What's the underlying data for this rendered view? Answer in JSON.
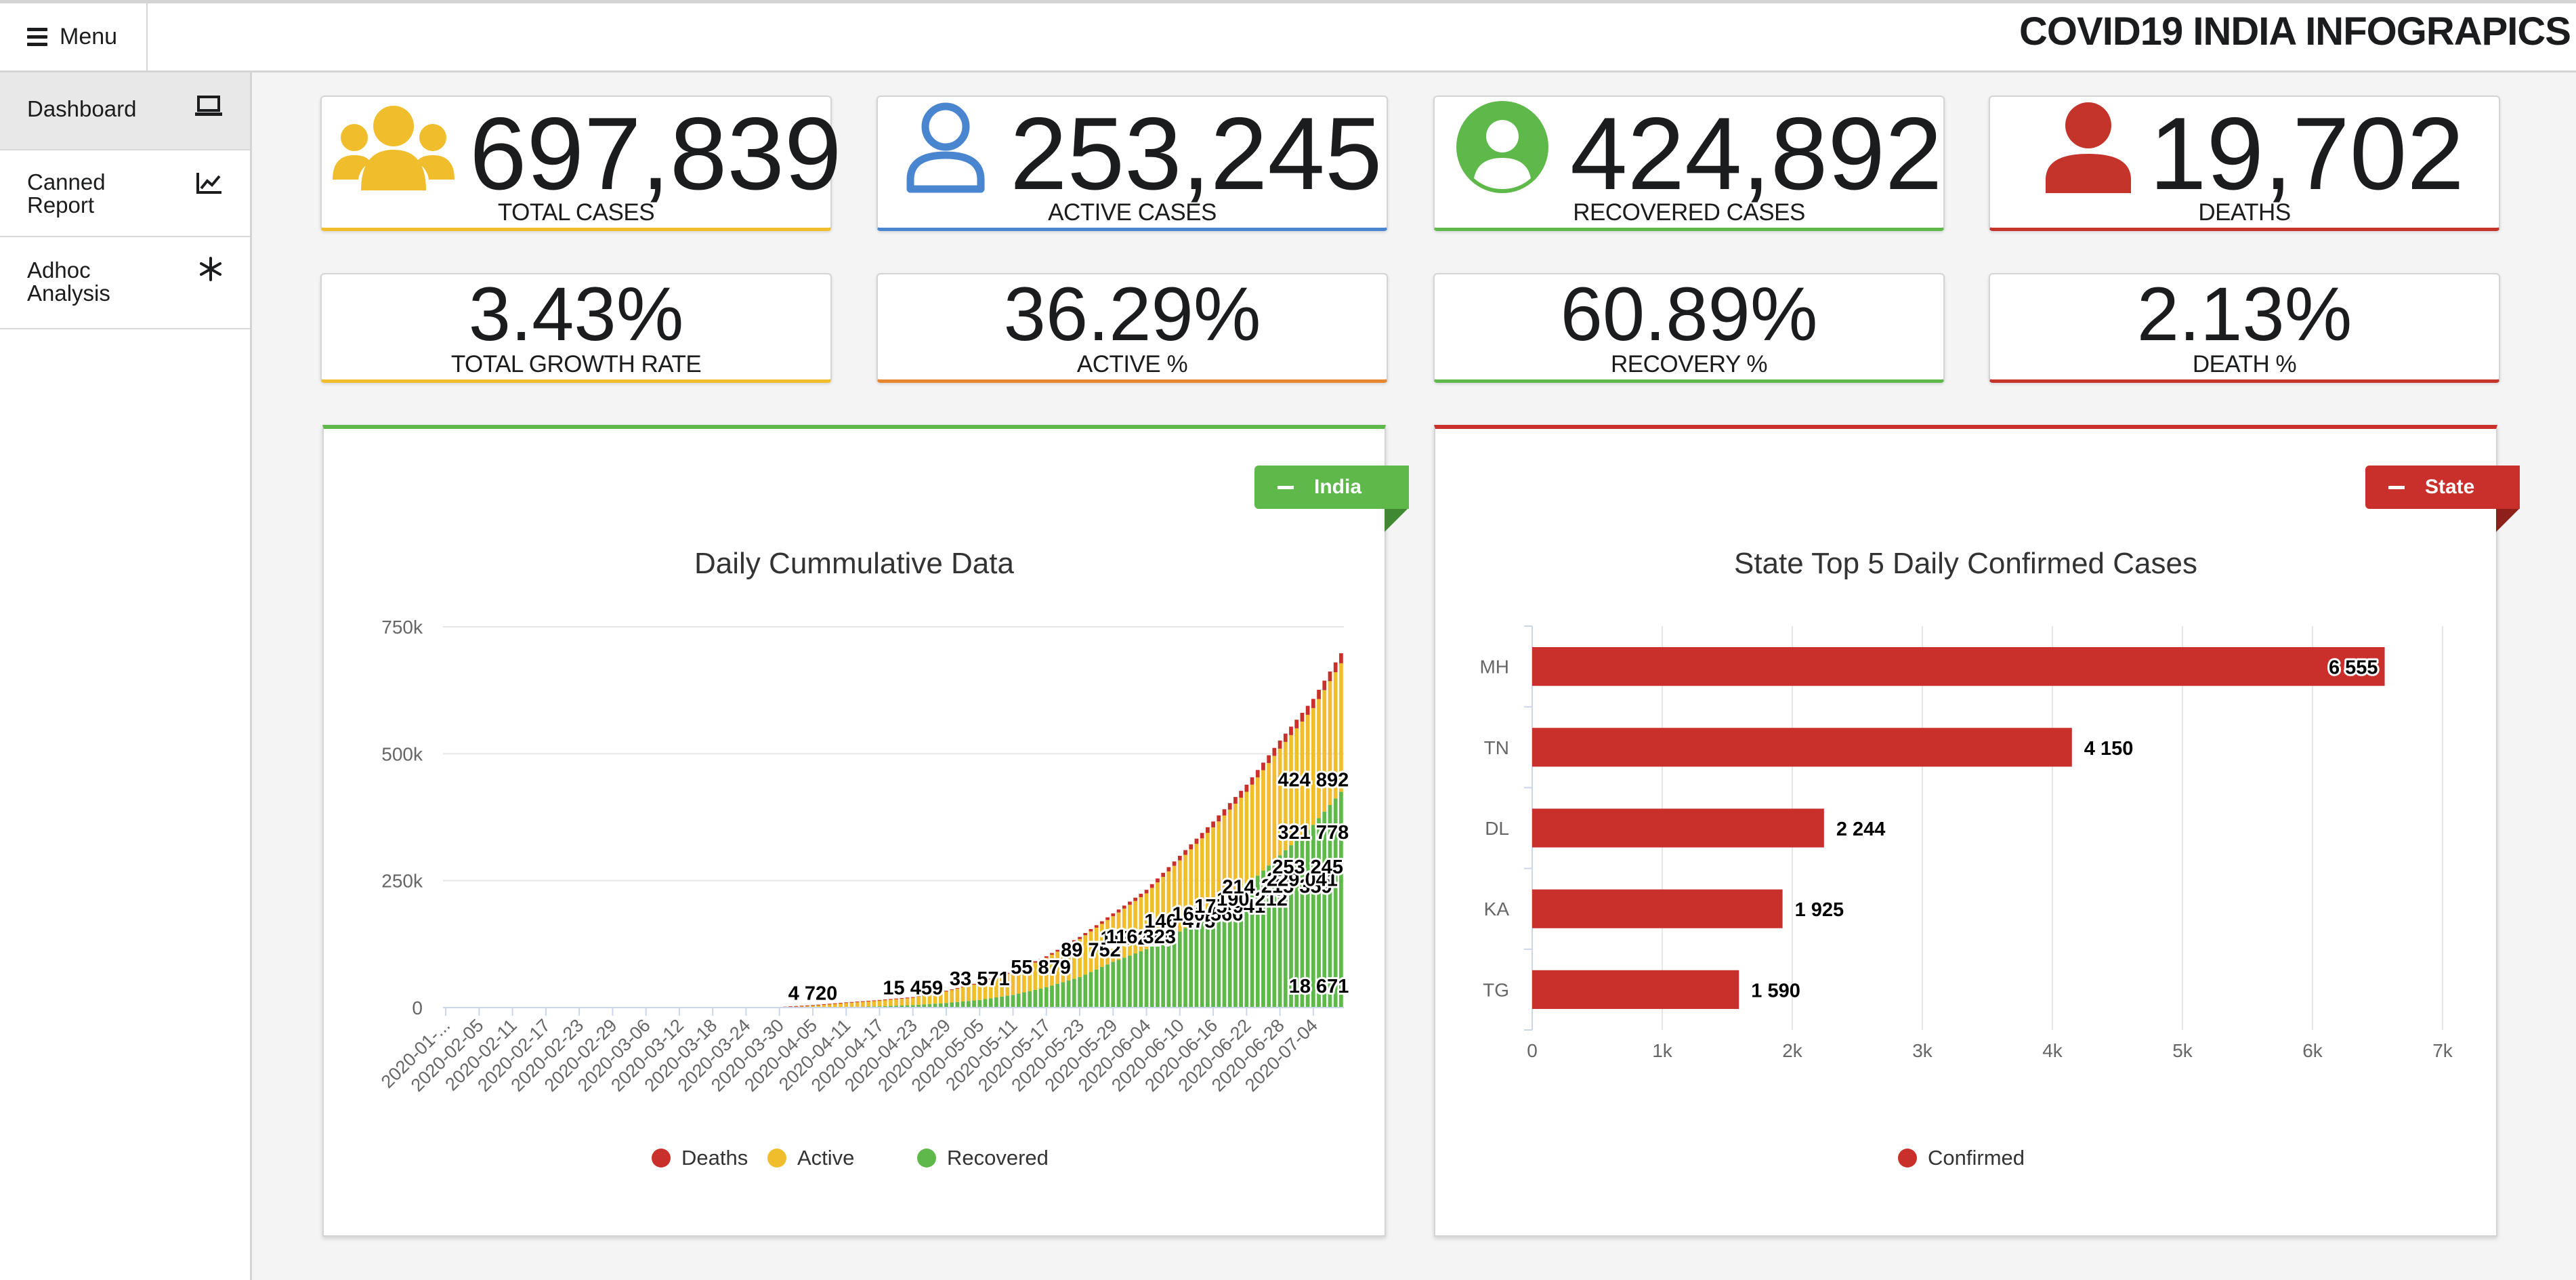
{
  "header": {
    "menu_label": "Menu",
    "app_title": "COVID19 INDIA INFOGRAPICS"
  },
  "sidebar": {
    "items": [
      {
        "label": "Dashboard",
        "icon": "laptop-icon",
        "active": true
      },
      {
        "label": "Canned Report",
        "icon": "line-chart-icon",
        "active": false
      },
      {
        "label": "Adhoc Analysis",
        "icon": "snowflake-icon",
        "active": false
      }
    ]
  },
  "stats": [
    {
      "value": "697,839",
      "label": "TOTAL CASES",
      "color": "#f0be2c",
      "icon": "users-icon"
    },
    {
      "value": "253,245",
      "label": "ACTIVE CASES",
      "color": "#4a86cf",
      "icon": "user-outline-icon"
    },
    {
      "value": "424,892",
      "label": "RECOVERED CASES",
      "color": "#5fb94a",
      "icon": "user-circle-icon"
    },
    {
      "value": "19,702",
      "label": "DEATHS",
      "color": "#c5342a",
      "icon": "user-icon"
    }
  ],
  "rates": [
    {
      "value": "3.43%",
      "label": "TOTAL GROWTH RATE",
      "color": "#f0be2c"
    },
    {
      "value": "36.29%",
      "label": "ACTIVE %",
      "color": "#e6862f"
    },
    {
      "value": "60.89%",
      "label": "RECOVERY %",
      "color": "#5fb94a"
    },
    {
      "value": "2.13%",
      "label": "DEATH %",
      "color": "#c5342a"
    }
  ],
  "colors": {
    "deaths": "#c9302c",
    "active": "#f0be2c",
    "recovered": "#5fb94a",
    "confirmed": "#c9302c",
    "india_tag": "#5fb94a",
    "state_tag": "#c9302c"
  },
  "left_card": {
    "tag": "India"
  },
  "right_card": {
    "tag": "State"
  },
  "chart_data": [
    {
      "type": "bar",
      "stacked": true,
      "title": "Daily Cummulative Data",
      "xlabel": "",
      "ylabel": "",
      "ylim": [
        0,
        750000
      ],
      "y_ticks": [
        "0",
        "250k",
        "500k",
        "750k"
      ],
      "y_tick_values": [
        0,
        250000,
        500000,
        750000
      ],
      "x_tick_labels": [
        "2020-01-...",
        "2020-02-05",
        "2020-02-11",
        "2020-02-17",
        "2020-02-23",
        "2020-02-29",
        "2020-03-06",
        "2020-03-12",
        "2020-03-18",
        "2020-03-24",
        "2020-03-30",
        "2020-04-05",
        "2020-04-11",
        "2020-04-17",
        "2020-04-23",
        "2020-04-29",
        "2020-05-05",
        "2020-05-11",
        "2020-05-17",
        "2020-05-23",
        "2020-05-29",
        "2020-06-04",
        "2020-06-10",
        "2020-06-16",
        "2020-06-22",
        "2020-06-28",
        "2020-07-04"
      ],
      "x_tick_day_index": [
        0,
        6,
        12,
        18,
        24,
        30,
        36,
        42,
        48,
        54,
        60,
        66,
        72,
        78,
        84,
        90,
        96,
        102,
        108,
        114,
        120,
        126,
        132,
        138,
        144,
        150,
        156
      ],
      "days": 162,
      "anchors": {
        "day": [
          0,
          40,
          50,
          60,
          66,
          72,
          78,
          84,
          90,
          96,
          102,
          108,
          114,
          120,
          126,
          132,
          138,
          144,
          150,
          156,
          161
        ],
        "recovered": [
          0,
          0,
          0,
          100,
          300,
          1000,
          2500,
          5000,
          9000,
          15000,
          25000,
          40000,
          60000,
          90000,
          115000,
          150000,
          190000,
          240000,
          300000,
          360000,
          424892
        ],
        "active": [
          0,
          40,
          150,
          1000,
          4500,
          9000,
          12000,
          15000,
          23000,
          33000,
          45000,
          58000,
          75000,
          90000,
          110000,
          140000,
          165000,
          185000,
          210000,
          230000,
          253245
        ],
        "deaths": [
          0,
          0,
          2,
          30,
          110,
          300,
          500,
          800,
          1100,
          1600,
          2300,
          3100,
          4200,
          5500,
          7000,
          9000,
          11500,
          14000,
          16000,
          18000,
          19702
        ]
      },
      "data_labels": [
        {
          "text": "4 720",
          "day": 66,
          "value": 4720
        },
        {
          "text": "15 459",
          "day": 84,
          "value": 15459
        },
        {
          "text": "33 571",
          "day": 96,
          "value": 33571
        },
        {
          "text": "55 879",
          "day": 107,
          "value": 55879
        },
        {
          "text": "89 752",
          "day": 116,
          "value": 89752
        },
        {
          "text": "113 224",
          "day": 124,
          "value": 113224
        },
        {
          "text": "116 323",
          "day": 125,
          "value": 116323
        },
        {
          "text": "146 475",
          "day": 132,
          "value": 146475
        },
        {
          "text": "160 566",
          "day": 137,
          "value": 160566
        },
        {
          "text": "175 941",
          "day": 141,
          "value": 175941
        },
        {
          "text": "190 212",
          "day": 145,
          "value": 190212
        },
        {
          "text": "214 210",
          "day": 146,
          "value": 214210
        },
        {
          "text": "215 359",
          "day": 153,
          "value": 215359
        },
        {
          "text": "229 041",
          "day": 154,
          "value": 229041
        },
        {
          "text": "253 245",
          "day": 155,
          "value": 253245
        },
        {
          "text": "321 778",
          "day": 156,
          "value": 321778
        },
        {
          "text": "424 892",
          "day": 156,
          "value": 424892
        },
        {
          "text": "18 671",
          "day": 157,
          "value": 18671
        }
      ],
      "series": [
        {
          "name": "Deaths"
        },
        {
          "name": "Active"
        },
        {
          "name": "Recovered"
        }
      ],
      "legend": "bottom"
    },
    {
      "type": "bar",
      "orientation": "horizontal",
      "title": "State Top 5 Daily Confirmed Cases",
      "xlabel": "",
      "ylabel": "",
      "categories": [
        "MH",
        "TN",
        "DL",
        "KA",
        "TG"
      ],
      "values": [
        6555,
        4150,
        2244,
        1925,
        1590
      ],
      "value_labels": [
        "6 555",
        "4 150",
        "2 244",
        "1 925",
        "1 590"
      ],
      "xlim": [
        0,
        7000
      ],
      "x_ticks": [
        "0",
        "1k",
        "2k",
        "3k",
        "4k",
        "5k",
        "6k",
        "7k"
      ],
      "series": [
        {
          "name": "Confirmed"
        }
      ],
      "legend": "bottom"
    }
  ]
}
